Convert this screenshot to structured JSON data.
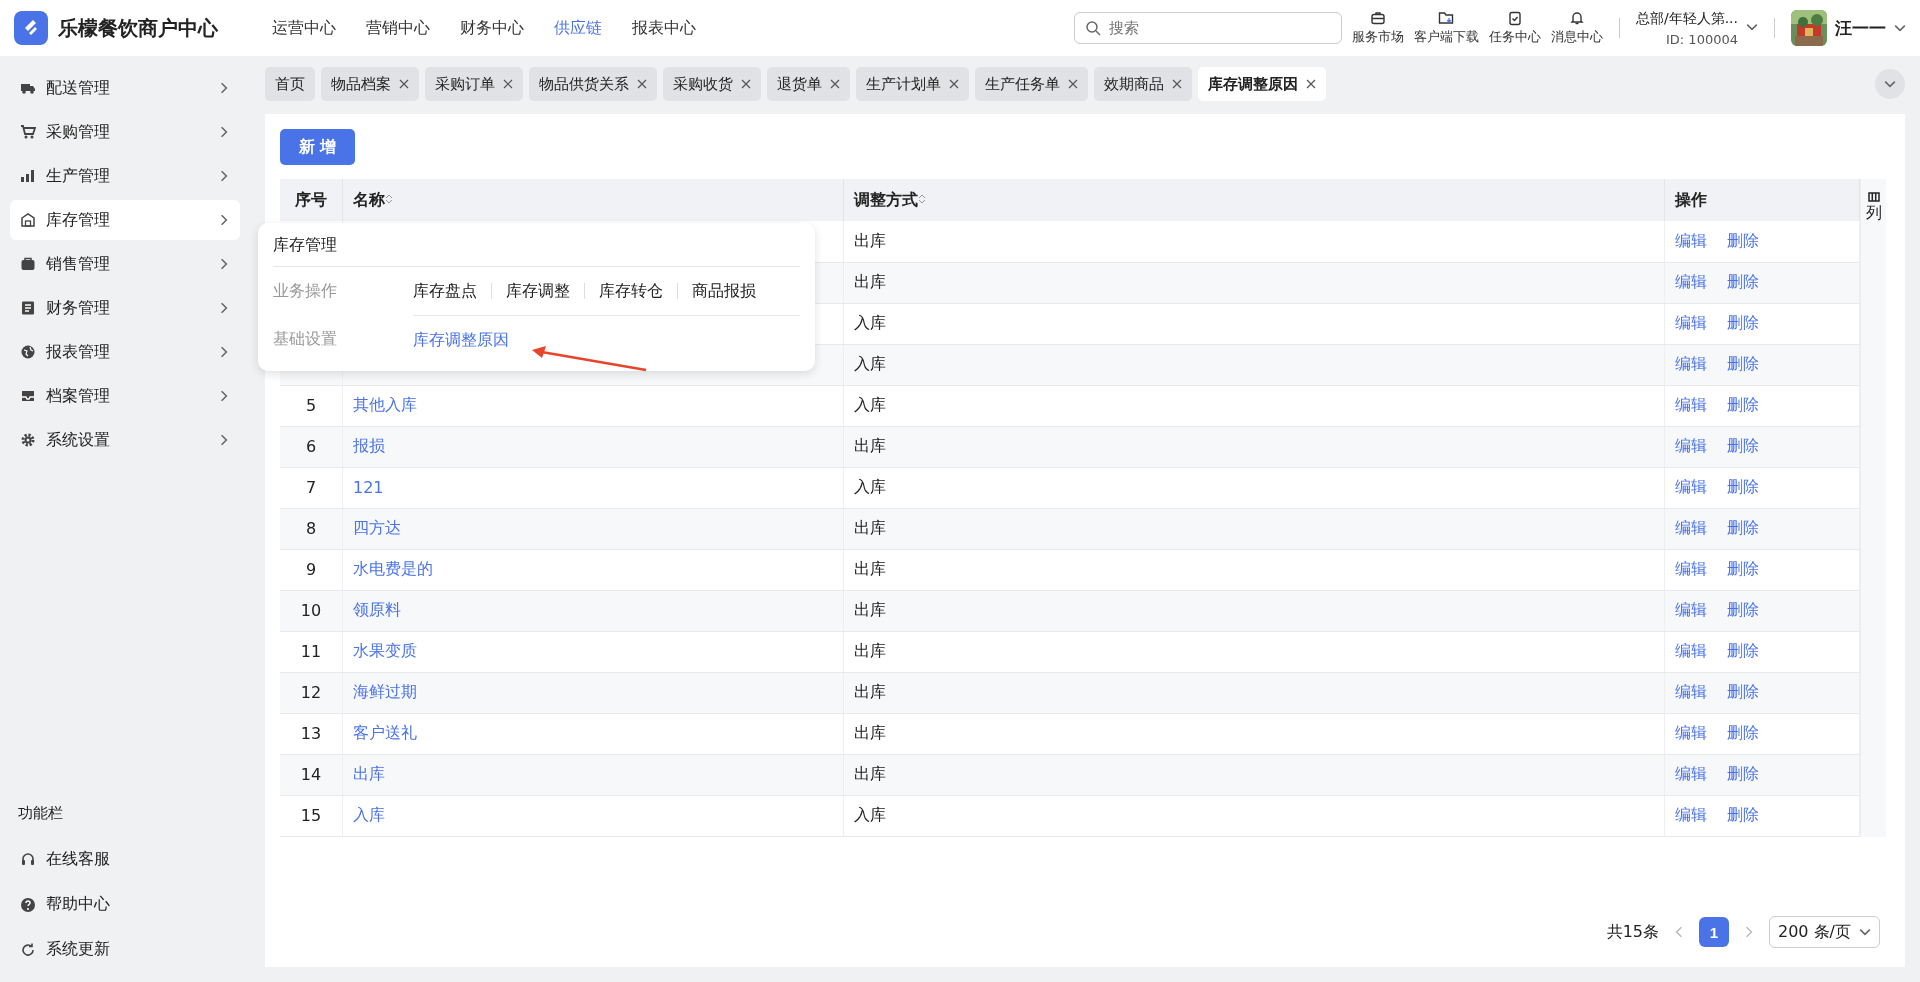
{
  "app": {
    "title": "乐檬餐饮商户中心"
  },
  "top_nav": [
    {
      "label": "运营中心",
      "selected": false
    },
    {
      "label": "营销中心",
      "selected": false
    },
    {
      "label": "财务中心",
      "selected": false
    },
    {
      "label": "供应链",
      "selected": true
    },
    {
      "label": "报表中心",
      "selected": false
    }
  ],
  "search": {
    "placeholder": "搜索"
  },
  "header_tools": [
    {
      "kind": "briefcase",
      "label": "服务市场"
    },
    {
      "kind": "folder",
      "label": "客户端下载"
    },
    {
      "kind": "clipboard",
      "label": "任务中心"
    },
    {
      "kind": "bell",
      "label": "消息中心"
    }
  ],
  "org": {
    "name": "总部/年轻人第...",
    "id": "ID: 100004"
  },
  "user": {
    "name": "汪一一"
  },
  "sidebar": {
    "items": [
      {
        "kind": "truck",
        "label": "配送管理",
        "selected": false
      },
      {
        "kind": "cart",
        "label": "采购管理",
        "selected": false
      },
      {
        "kind": "chart",
        "label": "生产管理",
        "selected": false
      },
      {
        "kind": "warehouse",
        "label": "库存管理",
        "selected": true
      },
      {
        "kind": "bag",
        "label": "销售管理",
        "selected": false
      },
      {
        "kind": "ledger",
        "label": "财务管理",
        "selected": false
      },
      {
        "kind": "globe",
        "label": "报表管理",
        "selected": false
      },
      {
        "kind": "inbox",
        "label": "档案管理",
        "selected": false
      },
      {
        "kind": "gear",
        "label": "系统设置",
        "selected": false
      }
    ],
    "footer_title": "功能栏",
    "footer_items": [
      {
        "kind": "headset",
        "label": "在线客服"
      },
      {
        "kind": "help",
        "label": "帮助中心"
      },
      {
        "kind": "refresh",
        "label": "系统更新"
      }
    ]
  },
  "tabs": [
    {
      "label": "首页",
      "closable": false,
      "selected": false
    },
    {
      "label": "物品档案",
      "closable": true,
      "selected": false
    },
    {
      "label": "采购订单",
      "closable": true,
      "selected": false
    },
    {
      "label": "物品供货关系",
      "closable": true,
      "selected": false
    },
    {
      "label": "采购收货",
      "closable": true,
      "selected": false
    },
    {
      "label": "退货单",
      "closable": true,
      "selected": false
    },
    {
      "label": "生产计划单",
      "closable": true,
      "selected": false
    },
    {
      "label": "生产任务单",
      "closable": true,
      "selected": false
    },
    {
      "label": "效期商品",
      "closable": true,
      "selected": false
    },
    {
      "label": "库存调整原因",
      "closable": true,
      "selected": true
    }
  ],
  "toolbar": {
    "add_button": "新 增"
  },
  "table": {
    "columns": [
      "序号",
      "名称",
      "调整方式",
      "操作"
    ],
    "column_settings": "列",
    "rows": [
      {
        "method": "出库",
        "actions": [
          "编辑",
          "删除"
        ]
      },
      {
        "method": "出库",
        "actions": [
          "编辑",
          "删除"
        ]
      },
      {
        "method": "入库",
        "actions": [
          "编辑",
          "删除"
        ]
      },
      {
        "method": "入库",
        "actions": [
          "编辑",
          "删除"
        ]
      },
      {
        "index": "5",
        "name": "其他入库",
        "method": "入库",
        "actions": [
          "编辑",
          "删除"
        ]
      },
      {
        "index": "6",
        "name": "报损",
        "method": "出库",
        "actions": [
          "编辑",
          "删除"
        ]
      },
      {
        "index": "7",
        "name": "121",
        "method": "入库",
        "actions": [
          "编辑",
          "删除"
        ]
      },
      {
        "index": "8",
        "name": "四方达",
        "method": "出库",
        "actions": [
          "编辑",
          "删除"
        ]
      },
      {
        "index": "9",
        "name": "水电费是的",
        "method": "出库",
        "actions": [
          "编辑",
          "删除"
        ]
      },
      {
        "index": "10",
        "name": "领原料",
        "method": "出库",
        "actions": [
          "编辑",
          "删除"
        ]
      },
      {
        "index": "11",
        "name": "水果变质",
        "method": "出库",
        "actions": [
          "编辑",
          "删除"
        ]
      },
      {
        "index": "12",
        "name": "海鲜过期",
        "method": "出库",
        "actions": [
          "编辑",
          "删除"
        ]
      },
      {
        "index": "13",
        "name": "客户送礼",
        "method": "出库",
        "actions": [
          "编辑",
          "删除"
        ]
      },
      {
        "index": "14",
        "name": "出库",
        "method": "出库",
        "actions": [
          "编辑",
          "删除"
        ]
      },
      {
        "index": "15",
        "name": "入库",
        "method": "入库",
        "actions": [
          "编辑",
          "删除"
        ]
      }
    ]
  },
  "pagination": {
    "total": "共15条",
    "pages": [
      {
        "label": "1",
        "selected": true
      }
    ],
    "page_size": "200 条/页"
  },
  "popup_menu": {
    "title": "库存管理",
    "groups": [
      {
        "label": "业务操作",
        "links": [
          {
            "label": "库存盘点",
            "selected": false
          },
          {
            "label": "库存调整",
            "selected": false
          },
          {
            "label": "库存转仓",
            "selected": false
          },
          {
            "label": "商品报损",
            "selected": false
          }
        ]
      },
      {
        "label": "基础设置",
        "links": [
          {
            "label": "库存调整原因",
            "selected": true
          }
        ]
      }
    ]
  }
}
